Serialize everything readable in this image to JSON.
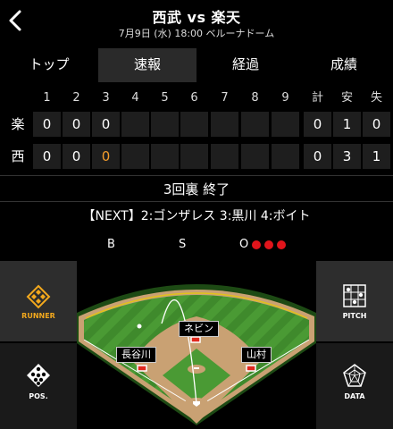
{
  "header": {
    "back_icon": "chevron-left-icon",
    "title": "西武 vs 楽天",
    "subtitle": "7月9日 (水) 18:00 ベルーナドーム"
  },
  "tabs": [
    {
      "label": "トップ",
      "active": false
    },
    {
      "label": "速報",
      "active": true
    },
    {
      "label": "経過",
      "active": false
    },
    {
      "label": "成績",
      "active": false
    }
  ],
  "scoreboard": {
    "headers": [
      "1",
      "2",
      "3",
      "4",
      "5",
      "6",
      "7",
      "8",
      "9",
      "計",
      "安",
      "失"
    ],
    "rows": [
      {
        "team": "楽",
        "innings": [
          "0",
          "0",
          "0",
          "",
          "",
          "",
          "",
          "",
          ""
        ],
        "totals": [
          "0",
          "1",
          "0"
        ]
      },
      {
        "team": "西",
        "innings": [
          "0",
          "0",
          "0",
          "",
          "",
          "",
          "",
          "",
          ""
        ],
        "totals": [
          "0",
          "3",
          "1"
        ]
      }
    ]
  },
  "status": {
    "result": "3回裏 終了",
    "next": "【NEXT】2:ゴンザレス 3:黒川 4:ボイト"
  },
  "count": {
    "ball_label": "B",
    "strike_label": "S",
    "out_label": "O",
    "outs": 3,
    "out_color": "#e1141b",
    "current_inning_color": "#f39c2b"
  },
  "side_buttons": {
    "runner": {
      "label": "RUNNER",
      "icon": "diamond-icon",
      "color": "#f2a81d"
    },
    "pos": {
      "label": "POS.",
      "icon": "position-dots-icon"
    },
    "pitch": {
      "label": "PITCH",
      "icon": "strike-zone-icon"
    },
    "data": {
      "label": "DATA",
      "icon": "radar-chart-icon"
    }
  },
  "field": {
    "players": [
      "ネビン",
      "長谷川",
      "山村"
    ]
  }
}
